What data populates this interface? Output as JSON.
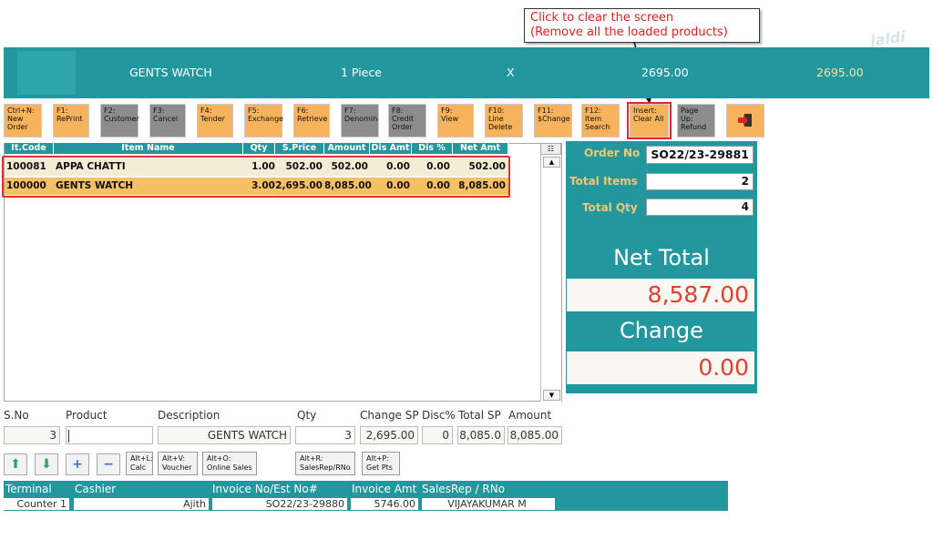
{
  "callout": {
    "line1": "Click to clear the screen",
    "line2": "(Remove all the loaded products)"
  },
  "watermark": "jaldi",
  "topbar": {
    "item": "GENTS WATCH",
    "qty": "1 Piece",
    "times": "X",
    "price": "2695.00",
    "total": "2695.00"
  },
  "toolbar": [
    {
      "key": "Ctrl+N:",
      "label": "New Order"
    },
    {
      "key": "F1:",
      "label": "RePrint"
    },
    {
      "key": "F2:",
      "label": "Customer"
    },
    {
      "key": "F3:",
      "label": "Cancel"
    },
    {
      "key": "F4:",
      "label": "Tender"
    },
    {
      "key": "F5:",
      "label": "Exchange"
    },
    {
      "key": "F6:",
      "label": "Retrieve"
    },
    {
      "key": "F7:",
      "label": "Denomina"
    },
    {
      "key": "F8:",
      "label": "Credit Order"
    },
    {
      "key": "F9:",
      "label": "View"
    },
    {
      "key": "F10:",
      "label": "Line Delete"
    },
    {
      "key": "F11:",
      "label": "$Change"
    },
    {
      "key": "F12:",
      "label": "Item Search"
    },
    {
      "key": "Insert:",
      "label": "Clear All"
    },
    {
      "key": "Page Up:",
      "label": "Refund"
    }
  ],
  "grid": {
    "headers": [
      "It.Code",
      "Item Name",
      "Qty",
      "S.Price",
      "Amount",
      "Dis Amt",
      "Dis %",
      "Net Amt"
    ],
    "rows": [
      [
        "100081",
        "APPA CHATTI",
        "1.00",
        "502.00",
        "502.00",
        "0.00",
        "0.00",
        "502.00"
      ],
      [
        "100000",
        "GENTS WATCH",
        "3.00",
        "2,695.00",
        "8,085.00",
        "0.00",
        "0.00",
        "8,085.00"
      ]
    ]
  },
  "summary": {
    "order_no_label": "Order No",
    "order_no": "SO22/23-29881",
    "total_items_label": "Total Items",
    "total_items": "2",
    "total_qty_label": "Total Qty",
    "total_qty": "4",
    "net_total_label": "Net Total",
    "net_total": "8,587.00",
    "change_label": "Change",
    "change": "0.00"
  },
  "entry": {
    "labels": {
      "sno": "S.No",
      "product": "Product",
      "description": "Description",
      "qty": "Qty",
      "change_sp": "Change SP",
      "disc": "Disc%",
      "total_sp": "Total SP",
      "amount": "Amount"
    },
    "values": {
      "sno": "3",
      "product": "",
      "description": "GENTS WATCH",
      "qty": "3",
      "change_sp": "2,695.00",
      "disc": "0",
      "total_sp": "8,085.0",
      "amount": "8,085.00"
    }
  },
  "shortcuts": {
    "calc": {
      "key": "Alt+L:",
      "label": "Calc"
    },
    "voucher": {
      "key": "Alt+V:",
      "label": "Voucher"
    },
    "online": {
      "key": "Alt+O:",
      "label": "Online Sales"
    },
    "salesrep": {
      "key": "Alt+R:",
      "label": "SalesRep/RNo"
    },
    "getpts": {
      "key": "Alt+P:",
      "label": "Get Pts"
    }
  },
  "footer": {
    "labels": {
      "terminal": "Terminal",
      "cashier": "Cashier",
      "invoice_no": "Invoice No/Est No#",
      "invoice_amt": "Invoice Amt",
      "salesrep": "SalesRep / RNo"
    },
    "values": {
      "terminal": "Counter 1",
      "cashier": "Ajith",
      "invoice_no": "SO22/23-29880",
      "invoice_amt": "5746.00",
      "salesrep": "VIJAYAKUMAR M"
    }
  },
  "colors": {
    "teal": "#23979e",
    "orange": "#f6b35b",
    "highlight_row": "#f8c064",
    "red": "#e04030"
  }
}
